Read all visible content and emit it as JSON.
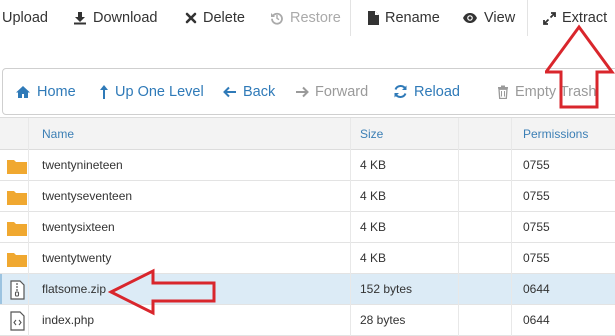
{
  "toolbar": {
    "upload": "Upload",
    "download": "Download",
    "delete": "Delete",
    "restore": "Restore",
    "rename": "Rename",
    "view": "View",
    "extract": "Extract"
  },
  "nav": {
    "home": "Home",
    "up_one_level": "Up One Level",
    "back": "Back",
    "forward": "Forward",
    "reload": "Reload",
    "empty_trash": "Empty Trash"
  },
  "table": {
    "headers": {
      "name": "Name",
      "size": "Size",
      "permissions": "Permissions"
    },
    "rows": [
      {
        "name": "twentynineteen",
        "size": "4 KB",
        "permissions": "0755",
        "type": "folder"
      },
      {
        "name": "twentyseventeen",
        "size": "4 KB",
        "permissions": "0755",
        "type": "folder"
      },
      {
        "name": "twentysixteen",
        "size": "4 KB",
        "permissions": "0755",
        "type": "folder"
      },
      {
        "name": "twentytwenty",
        "size": "4 KB",
        "permissions": "0755",
        "type": "folder"
      },
      {
        "name": "flatsome.zip",
        "size": "152 bytes",
        "permissions": "0644",
        "type": "zip"
      },
      {
        "name": "index.php",
        "size": "28 bytes",
        "permissions": "0644",
        "type": "code"
      }
    ]
  },
  "colors": {
    "link_blue": "#2f7ab8",
    "folder_orange": "#f0a830",
    "selected_row": "#dcebf6",
    "annotation_red": "#d9262c"
  },
  "icons": {
    "download": "download-icon",
    "delete": "x-icon",
    "restore": "restore-icon",
    "rename": "file-icon",
    "view": "eye-icon",
    "extract": "expand-icon",
    "home": "home-icon",
    "up": "up-arrow-icon",
    "back": "left-arrow-icon",
    "forward": "right-arrow-icon",
    "reload": "reload-icon",
    "trash": "trash-icon"
  }
}
